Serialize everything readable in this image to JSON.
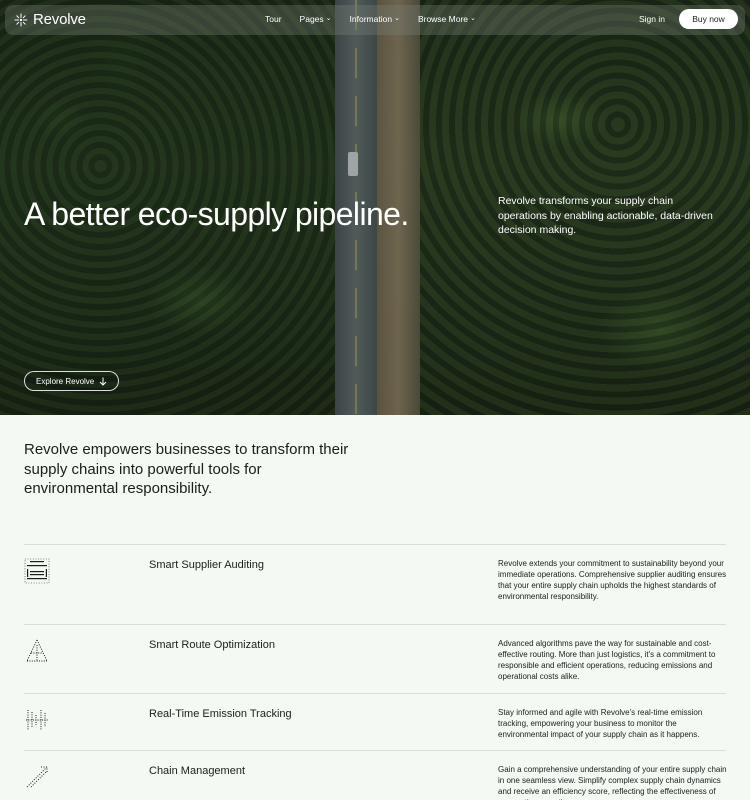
{
  "nav": {
    "logo": "Revolve",
    "links": [
      {
        "label": "Tour",
        "has_dropdown": false
      },
      {
        "label": "Pages",
        "has_dropdown": true
      },
      {
        "label": "Information",
        "has_dropdown": true
      },
      {
        "label": "Browse More",
        "has_dropdown": true
      }
    ],
    "sign_in": "Sign in",
    "buy_now": "Buy now"
  },
  "hero": {
    "title": "A better eco-supply pipeline.",
    "description": "Revolve transforms your supply chain operations by enabling actionable, data-driven decision making.",
    "explore_label": "Explore Revolve"
  },
  "intro": {
    "text": "Revolve empowers businesses to transform their supply chains into powerful tools for environmental responsibility."
  },
  "features": [
    {
      "icon": "supplier-audit-icon",
      "title": "Smart Supplier Auditing",
      "description": "Revolve extends your commitment to sustainability beyond your immediate operations. Comprehensive supplier auditing ensures that your entire supply chain upholds the highest standards of environmental responsibility."
    },
    {
      "icon": "route-optimization-icon",
      "title": "Smart Route Optimization",
      "description": "Advanced algorithms pave the way for sustainable and cost-effective routing. More than just logistics, it's a commitment to responsible and efficient operations, reducing emissions and operational costs alike."
    },
    {
      "icon": "emission-tracking-icon",
      "title": "Real-Time Emission Tracking",
      "description": "Stay informed and agile with Revolve's real-time emission tracking, empowering your business to monitor the environmental impact of your supply chain as it happens."
    },
    {
      "icon": "chain-management-icon",
      "title": "Chain Management",
      "description": "Gain a comprehensive understanding of your entire supply chain in one seamless view. Simplify complex supply chain dynamics and receive an efficiency score, reflecting the effectiveness of your entire operation."
    }
  ],
  "colors": {
    "background": "#f4f9f3",
    "text": "#1c1e1c",
    "divider": "#d9ded8"
  }
}
